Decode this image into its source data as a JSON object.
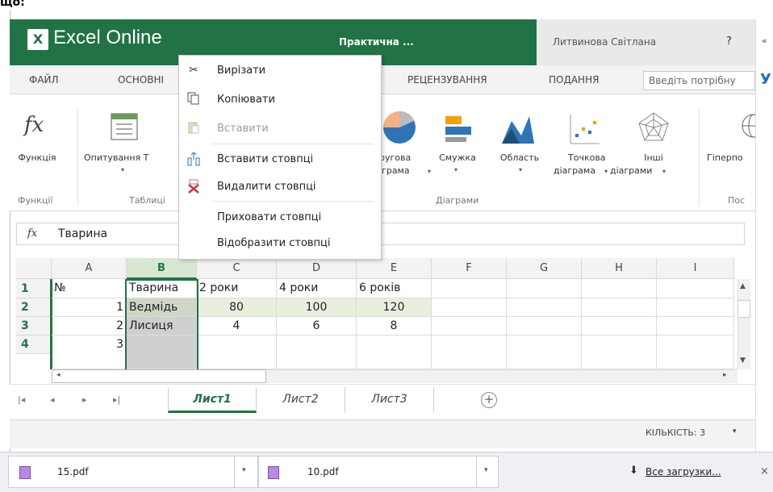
{
  "top_cut_text": "що:",
  "app": {
    "logo_letter": "X",
    "name": "Excel Online",
    "doc_title": "Практична ...",
    "user": "Литвинова Світлана",
    "help": "?"
  },
  "side": {
    "chevron": "«",
    "letter": "У"
  },
  "tabs": [
    "ФАЙЛ",
    "ОСНОВНІ",
    "РЕЦЕНЗУВАННЯ",
    "ПОДАННЯ"
  ],
  "search": {
    "placeholder": "Введіть потрібну"
  },
  "ribbon": {
    "function_label": "Функція",
    "survey_label": "Опитування Т",
    "pie_label_1": "ругова",
    "pie_label_2": "іграма",
    "bar_label": "Смужка",
    "area_label": "Область",
    "scatter_label_1": "Точкова",
    "scatter_label_2": "діаграма",
    "other_label_1": "Інші",
    "other_label_2": "діаграми",
    "hyperlink_label": "Гіперпо",
    "group_functions": "Функції",
    "group_tables": "Таблиці",
    "group_charts": "Діаграми",
    "group_links": "Пос"
  },
  "formula_bar": {
    "fx": "fx",
    "value": "Тварина"
  },
  "columns": [
    "A",
    "B",
    "C",
    "D",
    "E",
    "F",
    "G",
    "H",
    "I"
  ],
  "rows": [
    "1",
    "2",
    "3",
    "4"
  ],
  "cells": {
    "r1": [
      "№",
      "Тварина",
      "2 роки",
      "4 роки",
      "6 років"
    ],
    "r2": [
      "1",
      "Ведмідь",
      "80",
      "100",
      "120"
    ],
    "r3": [
      "2",
      "Лисиця",
      "4",
      "6",
      "8"
    ],
    "r4": [
      "3",
      "",
      "",
      "",
      ""
    ]
  },
  "sheets": [
    "Лист1",
    "Лист2",
    "Лист3"
  ],
  "sheet_nav": [
    "|◂",
    "◂",
    "▸",
    "▸|"
  ],
  "add_sheet": "+",
  "status": {
    "count": "КІЛЬКІСТЬ: 3",
    "arrow": "▾"
  },
  "context_menu": {
    "cut": "Вирізати",
    "copy": "Копіювати",
    "paste": "Вставити",
    "insert_cols": "Вставити стовпці",
    "delete_cols": "Видалити стовпці",
    "hide_cols": "Приховати стовпці",
    "show_cols": "Відобразити стовпці"
  },
  "downloads": {
    "file1": "15.pdf",
    "file2": "10.pdf",
    "all": "Все загрузки...",
    "close": "×",
    "arrow": "▾",
    "dl_icon": "⬇"
  },
  "colors": {
    "excel_green": "#217346",
    "selection_fill": "#e8f0dd",
    "selected_col": "#d0d0d0"
  }
}
